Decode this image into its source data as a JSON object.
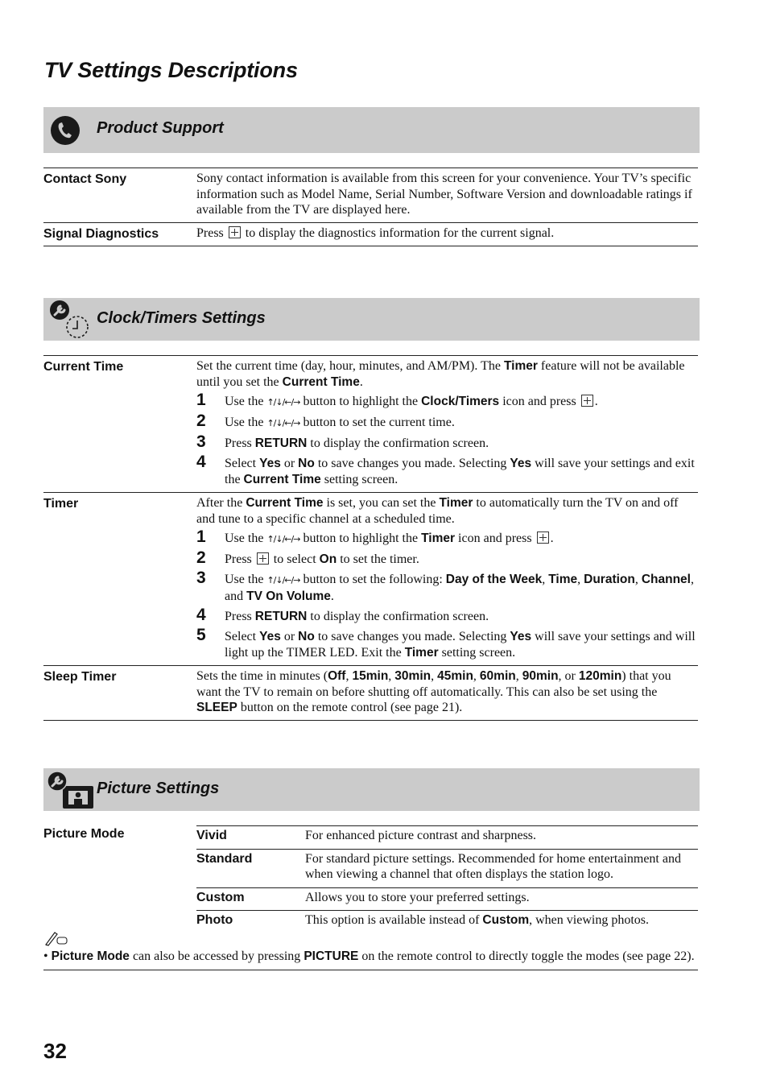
{
  "page": {
    "title": "TV Settings Descriptions",
    "page_number": "32"
  },
  "sections": {
    "product_support": {
      "title": "Product Support",
      "icon": "phone-icon",
      "rows": [
        {
          "label": "Contact Sony",
          "desc": "Sony contact information is available from this screen for your convenience. Your TV’s specific information such as Model Name, Serial Number, Software Version and downloadable ratings if available from the TV are displayed here."
        },
        {
          "label": "Signal Diagnostics",
          "desc_pre": "Press",
          "desc_post": "to display the diagnostics information for the current signal."
        }
      ]
    },
    "clock_timers": {
      "title": "Clock/Timers Settings",
      "icon": "clock-timers-settings-icon",
      "current_time": {
        "label": "Current Time",
        "intro": [
          "Set the current time (day, hour, minutes, and AM/PM). The ",
          "Timer",
          " feature will not be available until you set the ",
          "Current Time",
          "."
        ],
        "steps": [
          {
            "n": "1",
            "parts": [
              "Use the ",
              "↑/↓/←/→",
              " button to highlight the ",
              "Clock/Timers",
              " icon and press ",
              "."
            ]
          },
          {
            "n": "2",
            "parts": [
              "Use the ",
              "↑/↓/←/→",
              " button to set the current time."
            ]
          },
          {
            "n": "3",
            "parts": [
              "Press ",
              "RETURN",
              " to display the confirmation screen."
            ]
          },
          {
            "n": "4",
            "parts": [
              "Select ",
              "Yes",
              " or ",
              "No",
              " to save changes you made. Selecting ",
              "Yes",
              " will save your settings and exit the ",
              "Current Time",
              " setting screen."
            ]
          }
        ]
      },
      "timer": {
        "label": "Timer",
        "intro": [
          "After the ",
          "Current Time",
          " is set, you can set the ",
          "Timer",
          " to automatically turn the TV on and off and tune to a specific channel at a scheduled time."
        ],
        "steps": [
          {
            "n": "1",
            "parts": [
              "Use the ",
              "↑/↓/←/→",
              " button to highlight the ",
              "Timer",
              " icon and press ",
              "."
            ]
          },
          {
            "n": "2",
            "parts": [
              "Press ",
              "to select ",
              "On",
              " to set the timer."
            ]
          },
          {
            "n": "3",
            "parts": [
              "Use the ",
              "↑/↓/←/→",
              " button to set the following: ",
              "Day of the Week",
              ", ",
              "Time",
              ", ",
              "Duration",
              ", ",
              "Channel",
              ", and ",
              "TV On Volume",
              "."
            ]
          },
          {
            "n": "4",
            "parts": [
              "Press ",
              "RETURN",
              " to display the confirmation screen."
            ]
          },
          {
            "n": "5",
            "parts": [
              "Select ",
              "Yes",
              " or ",
              "No",
              " to save changes you made. Selecting ",
              "Yes",
              " will save your settings and will light up the TIMER LED. Exit the ",
              "Timer",
              " setting screen."
            ]
          }
        ]
      },
      "sleep_timer": {
        "label": "Sleep Timer",
        "parts": [
          "Sets the time in minutes (",
          "Off",
          ", ",
          "15min",
          ", ",
          "30min",
          ", ",
          "45min",
          ", ",
          "60min",
          ", ",
          "90min",
          ", or ",
          "120min",
          ") that you want the TV to remain on before shutting off automatically. This can also be set using the ",
          "SLEEP",
          " button on the remote control (see page 21)."
        ]
      }
    },
    "picture": {
      "title": "Picture Settings",
      "icon": "picture-settings-icon",
      "picture_mode": {
        "label": "Picture Mode",
        "options": [
          {
            "name": "Vivid",
            "desc": "For enhanced picture contrast and sharpness."
          },
          {
            "name": "Standard",
            "desc": "For standard picture settings. Recommended for home entertainment and when viewing a channel that often displays the station logo."
          },
          {
            "name": "Custom",
            "desc": "Allows you to store your preferred settings."
          },
          {
            "name": "Photo",
            "desc_parts": [
              "This option is available instead of ",
              "Custom",
              ", when viewing photos."
            ]
          }
        ]
      },
      "note": {
        "icon": "note-pencil-icon",
        "parts": [
          "• ",
          "Picture Mode",
          " can also be accessed by pressing ",
          "PICTURE",
          " on the remote control to directly toggle the modes (see page 22)."
        ]
      }
    }
  }
}
